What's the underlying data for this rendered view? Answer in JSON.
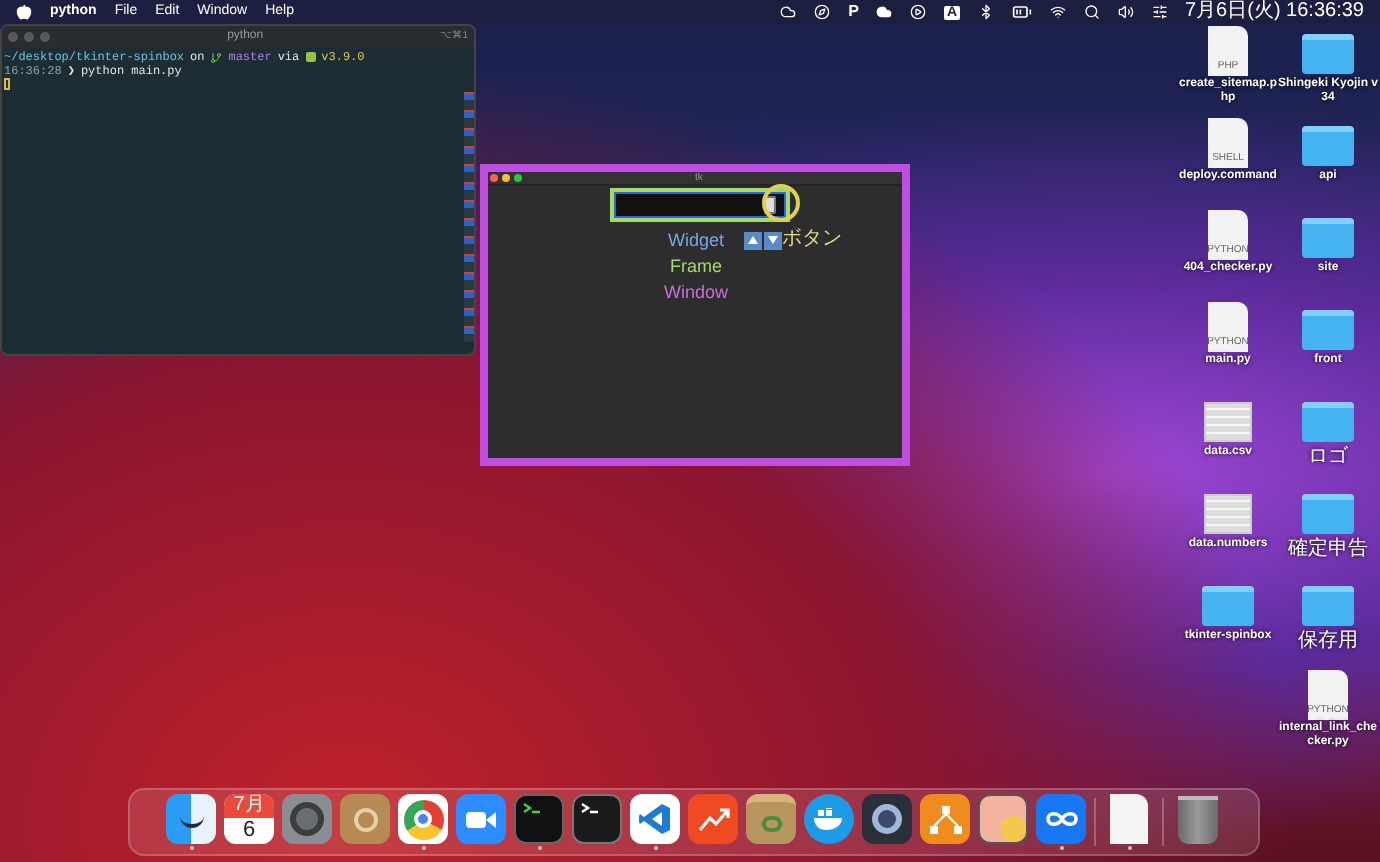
{
  "menu_bar": {
    "app": "python",
    "menus": [
      "File",
      "Edit",
      "Window",
      "Help"
    ],
    "status_letters": [
      "P",
      "A"
    ],
    "clock": "7月6日(火) 16:36:39"
  },
  "terminal": {
    "title": "python",
    "shortcut": "⌥⌘1",
    "prompt": [
      {
        "kind": "path",
        "text": "~/desktop/tkinter-spinbox"
      },
      {
        "kind": "plain",
        "text": "on"
      },
      {
        "kind": "branch",
        "text": "master"
      },
      {
        "kind": "plain",
        "text": "via"
      },
      {
        "kind": "version",
        "text": "v3.9.0"
      }
    ],
    "time": "16:36:28",
    "arrow": "❯",
    "command": "python main.py"
  },
  "tk_window": {
    "title": "tk",
    "rows": [
      {
        "text": "Widget",
        "color": "#7aa6e8",
        "button_label": "ボタン"
      },
      {
        "text": "Frame",
        "color": "#a6d86a"
      },
      {
        "text": "Window",
        "color": "#c76ee0"
      }
    ]
  },
  "desktop_columns": [
    [
      {
        "kind": "document",
        "label": "create_sitemap.php",
        "tag": "PHP"
      },
      {
        "kind": "document",
        "label": "deploy.command",
        "tag": "SHELL"
      },
      {
        "kind": "document",
        "label": "404_checker.py",
        "tag": "PYTHON"
      },
      {
        "kind": "document",
        "label": "main.py",
        "tag": "PYTHON"
      },
      {
        "kind": "sheet",
        "label": "data.csv"
      },
      {
        "kind": "sheet",
        "label": "data.numbers"
      },
      {
        "kind": "folder",
        "label": "tkinter-spinbox"
      }
    ],
    [
      {
        "kind": "folder",
        "label": "Shingeki Kyojin v34"
      },
      {
        "kind": "folder",
        "label": "api"
      },
      {
        "kind": "folder",
        "label": "site"
      },
      {
        "kind": "folder",
        "label": "front"
      },
      {
        "kind": "folder",
        "label": "ロゴ"
      },
      {
        "kind": "folder",
        "label": "確定申告"
      },
      {
        "kind": "folder",
        "label": "保存用"
      },
      {
        "kind": "document",
        "label": "internal_link_checker.py",
        "tag": "PYTHON"
      }
    ]
  ],
  "dock": {
    "items": [
      {
        "kind": "finder",
        "running": true
      },
      {
        "kind": "calendar",
        "running": false,
        "month": "7月",
        "day": "6"
      },
      {
        "kind": "settings",
        "running": false
      },
      {
        "kind": "contacts",
        "running": false
      },
      {
        "kind": "chrome",
        "running": true
      },
      {
        "kind": "video",
        "running": false
      },
      {
        "kind": "iterm",
        "running": true
      },
      {
        "kind": "terminal",
        "running": false
      },
      {
        "kind": "vscode",
        "running": true
      },
      {
        "kind": "chart",
        "running": false
      },
      {
        "kind": "archive",
        "running": false
      },
      {
        "kind": "docker",
        "running": false
      },
      {
        "kind": "quicktime",
        "running": false
      },
      {
        "kind": "diagram",
        "running": false
      },
      {
        "kind": "preview",
        "running": false
      },
      {
        "kind": "infinity",
        "running": true
      },
      {
        "kind": "separator"
      },
      {
        "kind": "file",
        "running": true
      },
      {
        "kind": "separator"
      },
      {
        "kind": "trash",
        "running": false
      }
    ]
  }
}
